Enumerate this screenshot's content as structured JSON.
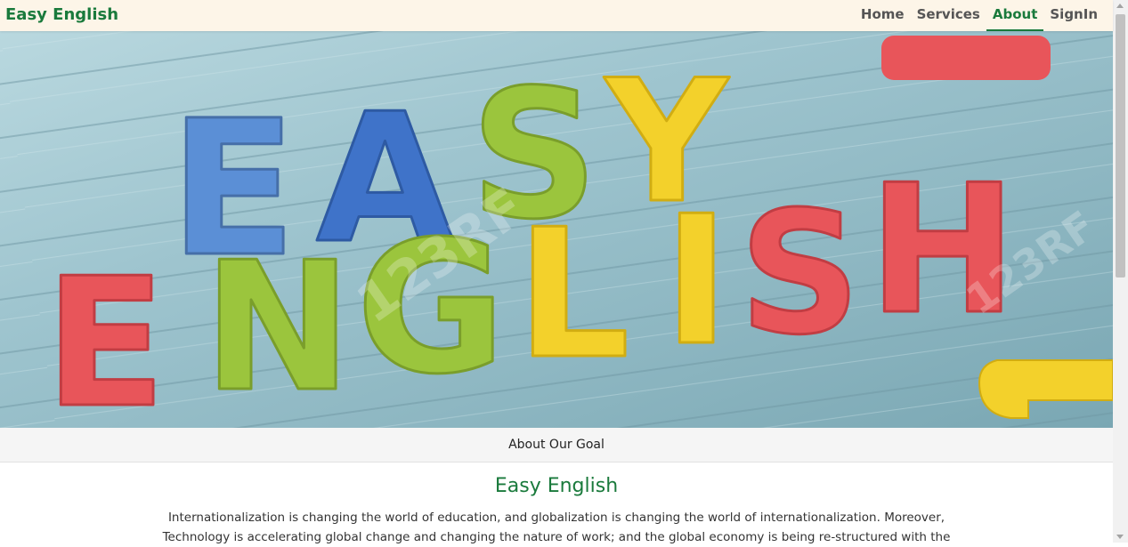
{
  "brand": {
    "name": "Easy English"
  },
  "nav": {
    "items": [
      {
        "label": "Home"
      },
      {
        "label": "Services"
      },
      {
        "label": "About"
      },
      {
        "label": "SignIn"
      }
    ],
    "active": "About"
  },
  "hero": {
    "image": "colorful foam letters",
    "letters_top": [
      "E",
      "A",
      "S",
      "Y"
    ],
    "letters_bottom": [
      "E",
      "N",
      "G",
      "L",
      "I",
      "S",
      "H"
    ],
    "watermark": "123RF"
  },
  "caption": {
    "text": "About Our Goal"
  },
  "section": {
    "title": "Easy English",
    "paragraph": "Internationalization is changing the world of education, and globalization is changing the world of internationalization. Moreover, Technology is accelerating global change and changing the nature of work; and the global economy is being re-structured with the"
  },
  "colors": {
    "accent": "#1a7a3c",
    "navbar_bg": "#fdf5e8",
    "letter_red": "#e8555a",
    "letter_blue": "#5b8fd6",
    "letter_green": "#9bc53d",
    "letter_yellow": "#f3d12b"
  }
}
